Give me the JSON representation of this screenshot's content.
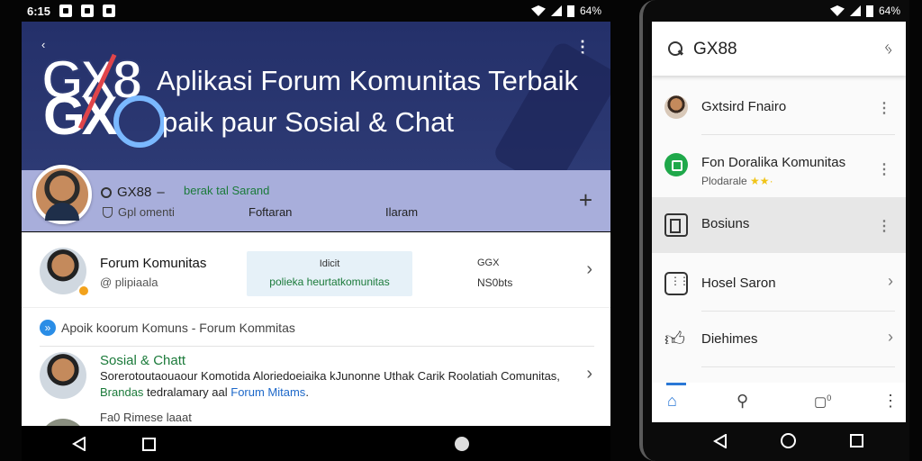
{
  "left_phone": {
    "status": {
      "time": "6:15",
      "battery": "64%"
    },
    "banner": {
      "logo": "GX8",
      "title": "Aplikasi Forum Komunitas Terbaik",
      "subtitle": "paik paur Sosial & Chat"
    },
    "profile_strip": {
      "name": "GX88",
      "dash": "–",
      "badge": "berak tal Sarand",
      "row2_label": "Gpl omenti",
      "tab1": "Foftaran",
      "tab2": "Ilaram"
    },
    "forum_row": {
      "title": "Forum Komunitas",
      "subtitle": "@ plipiaala",
      "card_line1": "Idicit",
      "card_line2": "polieka heurtatkomunitas",
      "stat1": "GGX",
      "stat2": "NS0bts"
    },
    "app_line": "Apoik koorum Komuns - Forum Kommitas",
    "social_row": {
      "title": "Sosial & Chatt",
      "body_part1": "Sorerotoutaouaour Komotida Aloriedoeiaika kJunonne Uthak Carik Roolatiah Comunitas, ",
      "body_green": "Brandas",
      "body_part2": " tedralamary aal ",
      "body_blue": "Forum Mitams",
      "body_end": "."
    },
    "partial_row": "Fa0 Rimese laaat"
  },
  "right_phone": {
    "status": {
      "battery": "64%"
    },
    "search": {
      "placeholder": "GX88"
    },
    "items": [
      {
        "label": "Gxtsird Fnairo",
        "sub": ""
      },
      {
        "label": "Fon Doralika Komunitas",
        "sub": "Plodarale",
        "stars": "★★·"
      },
      {
        "label": "Bosiuns",
        "sub": ""
      },
      {
        "label": "Hosel Saron",
        "sub": ""
      },
      {
        "label": "Diehimes",
        "sub": ""
      }
    ],
    "bottom_nav_badge": "0"
  }
}
